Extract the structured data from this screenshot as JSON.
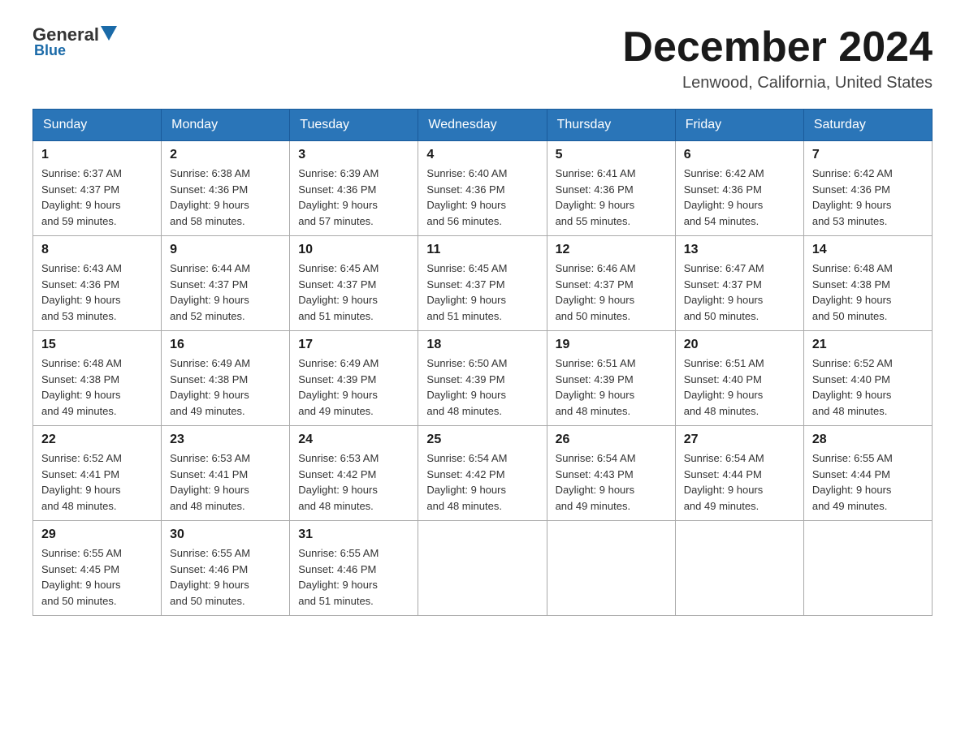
{
  "logo": {
    "general": "General",
    "blue": "Blue"
  },
  "header": {
    "month": "December 2024",
    "location": "Lenwood, California, United States"
  },
  "weekdays": [
    "Sunday",
    "Monday",
    "Tuesday",
    "Wednesday",
    "Thursday",
    "Friday",
    "Saturday"
  ],
  "weeks": [
    [
      {
        "day": "1",
        "sunrise": "6:37 AM",
        "sunset": "4:37 PM",
        "daylight": "9 hours and 59 minutes."
      },
      {
        "day": "2",
        "sunrise": "6:38 AM",
        "sunset": "4:36 PM",
        "daylight": "9 hours and 58 minutes."
      },
      {
        "day": "3",
        "sunrise": "6:39 AM",
        "sunset": "4:36 PM",
        "daylight": "9 hours and 57 minutes."
      },
      {
        "day": "4",
        "sunrise": "6:40 AM",
        "sunset": "4:36 PM",
        "daylight": "9 hours and 56 minutes."
      },
      {
        "day": "5",
        "sunrise": "6:41 AM",
        "sunset": "4:36 PM",
        "daylight": "9 hours and 55 minutes."
      },
      {
        "day": "6",
        "sunrise": "6:42 AM",
        "sunset": "4:36 PM",
        "daylight": "9 hours and 54 minutes."
      },
      {
        "day": "7",
        "sunrise": "6:42 AM",
        "sunset": "4:36 PM",
        "daylight": "9 hours and 53 minutes."
      }
    ],
    [
      {
        "day": "8",
        "sunrise": "6:43 AM",
        "sunset": "4:36 PM",
        "daylight": "9 hours and 53 minutes."
      },
      {
        "day": "9",
        "sunrise": "6:44 AM",
        "sunset": "4:37 PM",
        "daylight": "9 hours and 52 minutes."
      },
      {
        "day": "10",
        "sunrise": "6:45 AM",
        "sunset": "4:37 PM",
        "daylight": "9 hours and 51 minutes."
      },
      {
        "day": "11",
        "sunrise": "6:45 AM",
        "sunset": "4:37 PM",
        "daylight": "9 hours and 51 minutes."
      },
      {
        "day": "12",
        "sunrise": "6:46 AM",
        "sunset": "4:37 PM",
        "daylight": "9 hours and 50 minutes."
      },
      {
        "day": "13",
        "sunrise": "6:47 AM",
        "sunset": "4:37 PM",
        "daylight": "9 hours and 50 minutes."
      },
      {
        "day": "14",
        "sunrise": "6:48 AM",
        "sunset": "4:38 PM",
        "daylight": "9 hours and 50 minutes."
      }
    ],
    [
      {
        "day": "15",
        "sunrise": "6:48 AM",
        "sunset": "4:38 PM",
        "daylight": "9 hours and 49 minutes."
      },
      {
        "day": "16",
        "sunrise": "6:49 AM",
        "sunset": "4:38 PM",
        "daylight": "9 hours and 49 minutes."
      },
      {
        "day": "17",
        "sunrise": "6:49 AM",
        "sunset": "4:39 PM",
        "daylight": "9 hours and 49 minutes."
      },
      {
        "day": "18",
        "sunrise": "6:50 AM",
        "sunset": "4:39 PM",
        "daylight": "9 hours and 48 minutes."
      },
      {
        "day": "19",
        "sunrise": "6:51 AM",
        "sunset": "4:39 PM",
        "daylight": "9 hours and 48 minutes."
      },
      {
        "day": "20",
        "sunrise": "6:51 AM",
        "sunset": "4:40 PM",
        "daylight": "9 hours and 48 minutes."
      },
      {
        "day": "21",
        "sunrise": "6:52 AM",
        "sunset": "4:40 PM",
        "daylight": "9 hours and 48 minutes."
      }
    ],
    [
      {
        "day": "22",
        "sunrise": "6:52 AM",
        "sunset": "4:41 PM",
        "daylight": "9 hours and 48 minutes."
      },
      {
        "day": "23",
        "sunrise": "6:53 AM",
        "sunset": "4:41 PM",
        "daylight": "9 hours and 48 minutes."
      },
      {
        "day": "24",
        "sunrise": "6:53 AM",
        "sunset": "4:42 PM",
        "daylight": "9 hours and 48 minutes."
      },
      {
        "day": "25",
        "sunrise": "6:54 AM",
        "sunset": "4:42 PM",
        "daylight": "9 hours and 48 minutes."
      },
      {
        "day": "26",
        "sunrise": "6:54 AM",
        "sunset": "4:43 PM",
        "daylight": "9 hours and 49 minutes."
      },
      {
        "day": "27",
        "sunrise": "6:54 AM",
        "sunset": "4:44 PM",
        "daylight": "9 hours and 49 minutes."
      },
      {
        "day": "28",
        "sunrise": "6:55 AM",
        "sunset": "4:44 PM",
        "daylight": "9 hours and 49 minutes."
      }
    ],
    [
      {
        "day": "29",
        "sunrise": "6:55 AM",
        "sunset": "4:45 PM",
        "daylight": "9 hours and 50 minutes."
      },
      {
        "day": "30",
        "sunrise": "6:55 AM",
        "sunset": "4:46 PM",
        "daylight": "9 hours and 50 minutes."
      },
      {
        "day": "31",
        "sunrise": "6:55 AM",
        "sunset": "4:46 PM",
        "daylight": "9 hours and 51 minutes."
      },
      null,
      null,
      null,
      null
    ]
  ]
}
